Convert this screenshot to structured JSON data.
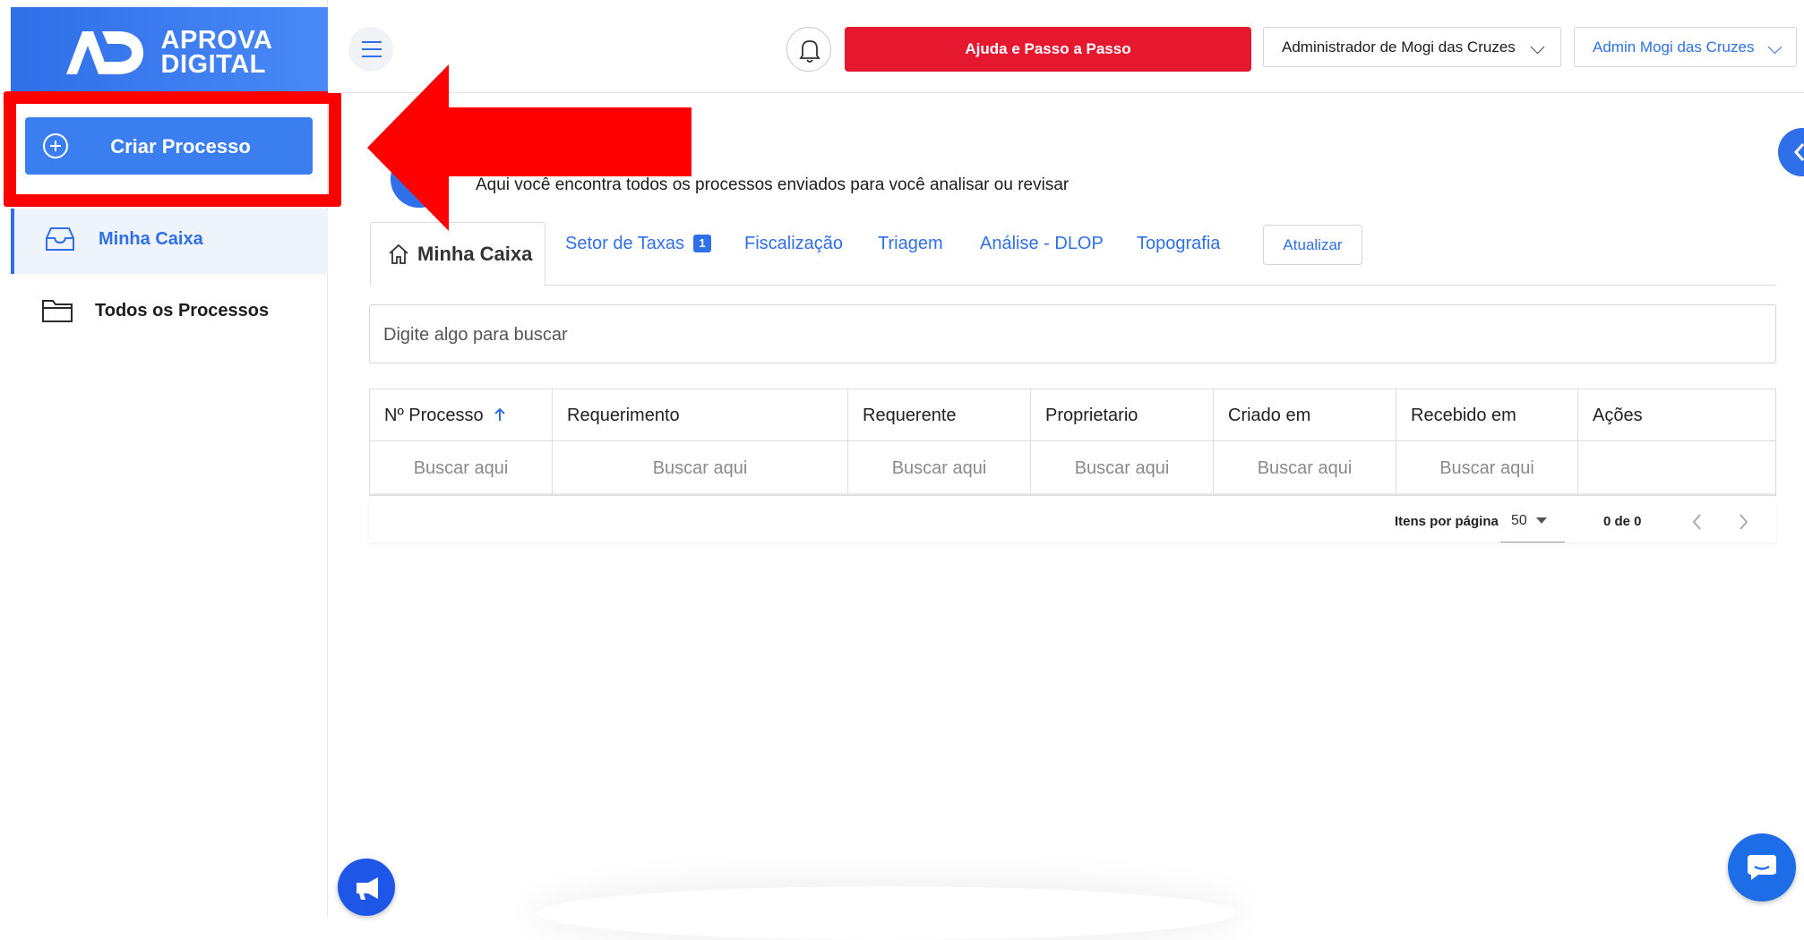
{
  "brand": {
    "line1": "APROVA",
    "line2": "DIGITAL",
    "accent": "#2f6fe8"
  },
  "sidebar": {
    "create_button": "Criar Processo",
    "items": [
      {
        "label": "Minha Caixa",
        "active": true
      },
      {
        "label": "Todos os Processos",
        "active": false
      }
    ]
  },
  "header": {
    "help_button": "Ajuda e Passo a Passo",
    "org_select": "Administrador de Mogi das Cruzes",
    "user_select": "Admin Mogi das Cruzes"
  },
  "main": {
    "subtitle": "Aqui você encontra todos os processos enviados para você analisar ou revisar",
    "tabs": [
      {
        "label": "Minha Caixa",
        "active": true
      },
      {
        "label": "Setor de Taxas",
        "badge": "1"
      },
      {
        "label": "Fiscalização"
      },
      {
        "label": "Triagem"
      },
      {
        "label": "Análise - DLOP"
      },
      {
        "label": "Topografia"
      }
    ],
    "refresh_button": "Atualizar",
    "search_placeholder": "Digite algo para buscar",
    "table": {
      "columns": [
        "Nº Processo",
        "Requerimento",
        "Requerente",
        "Proprietario",
        "Criado em",
        "Recebido em",
        "Ações"
      ],
      "filter_placeholder": "Buscar aqui"
    },
    "pagination": {
      "items_per_page_label": "Itens por página",
      "items_per_page": "50",
      "range": "0 de 0"
    }
  },
  "colors": {
    "help_button": "#e5182f",
    "annotation_arrow": "#ff0000"
  }
}
